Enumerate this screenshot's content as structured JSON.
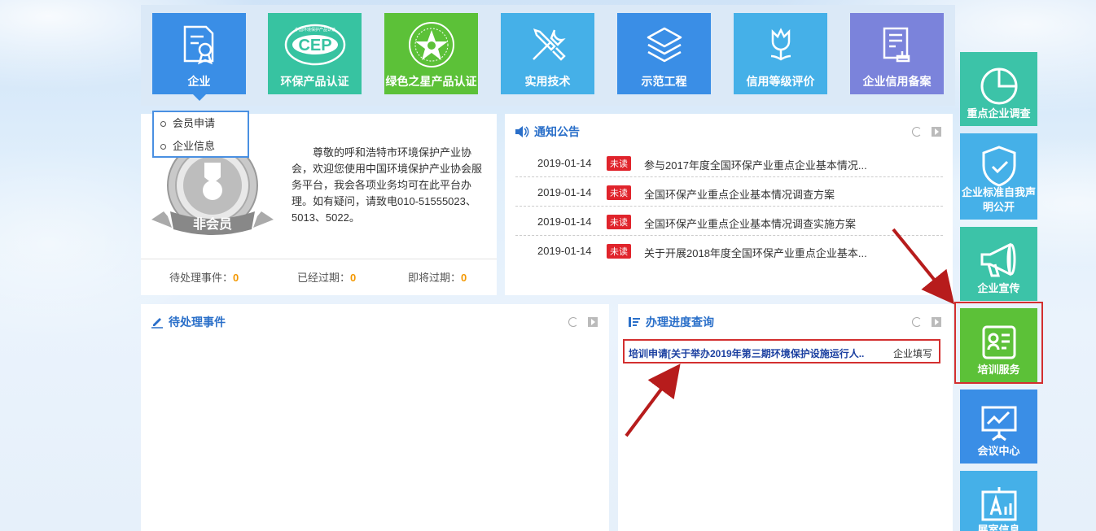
{
  "top_tiles": [
    {
      "label": "企业",
      "icon": "certificate-icon",
      "color": "#3a8ee6"
    },
    {
      "label": "环保产品认证",
      "icon": "cep-logo",
      "color": "#37c3a1",
      "logo_text": "CEP",
      "logo_sub": "中国环境保护产品认证"
    },
    {
      "label": "绿色之星产品认证",
      "icon": "green-star-logo",
      "color": "#5cc138"
    },
    {
      "label": "实用技术",
      "icon": "wrench-screwdriver-icon",
      "color": "#45b0e8"
    },
    {
      "label": "示范工程",
      "icon": "layers-icon",
      "color": "#3a8ee6"
    },
    {
      "label": "信用等级评价",
      "icon": "flower-icon",
      "color": "#45b0e8"
    },
    {
      "label": "企业信用备案",
      "icon": "document-stamp-icon",
      "color": "#7b83db"
    }
  ],
  "dropdown": {
    "items": [
      "会员申请",
      "企业信息"
    ]
  },
  "member": {
    "badge_label": "非会员",
    "welcome": "尊敬的呼和浩特市环境保护产业协会，欢迎您使用中国环境保护产业协会服务平台，我会各项业务均可在此平台办理。如有疑问，请致电010-51555023、5013、5022。",
    "stats": [
      {
        "label": "待处理事件：",
        "value": "0"
      },
      {
        "label": "已经过期：",
        "value": "0"
      },
      {
        "label": "即将过期：",
        "value": "0"
      }
    ]
  },
  "notices": {
    "title": "通知公告",
    "items": [
      {
        "date": "2019-01-14",
        "badge": "未读",
        "title": "参与2017年度全国环保产业重点企业基本情况..."
      },
      {
        "date": "2019-01-14",
        "badge": "未读",
        "title": "全国环保产业重点企业基本情况调查方案"
      },
      {
        "date": "2019-01-14",
        "badge": "未读",
        "title": "全国环保产业重点企业基本情况调查实施方案"
      },
      {
        "date": "2019-01-14",
        "badge": "未读",
        "title": "关于开展2018年度全国环保产业重点企业基本..."
      }
    ]
  },
  "pending": {
    "title": "待处理事件"
  },
  "progress": {
    "title": "办理进度查询",
    "item": {
      "title": "培训申请[关于举办2019年第三期环境保护设施运行人..",
      "status": "企业填写"
    }
  },
  "sidebar": [
    {
      "label": "重点企业调查",
      "icon": "pie-chart-icon",
      "color": "#3cc3a8"
    },
    {
      "label": "企业标准自我声明公开",
      "icon": "shield-icon",
      "color": "#45b0e8"
    },
    {
      "label": "企业宣传",
      "icon": "megaphone-icon",
      "color": "#3cc3a8"
    },
    {
      "label": "培训服务",
      "icon": "training-icon",
      "color": "#5cc138"
    },
    {
      "label": "会议中心",
      "icon": "presentation-icon",
      "color": "#3a8ee6"
    },
    {
      "label": "展室信息",
      "icon": "easel-icon",
      "color": "#45b0e8"
    }
  ]
}
